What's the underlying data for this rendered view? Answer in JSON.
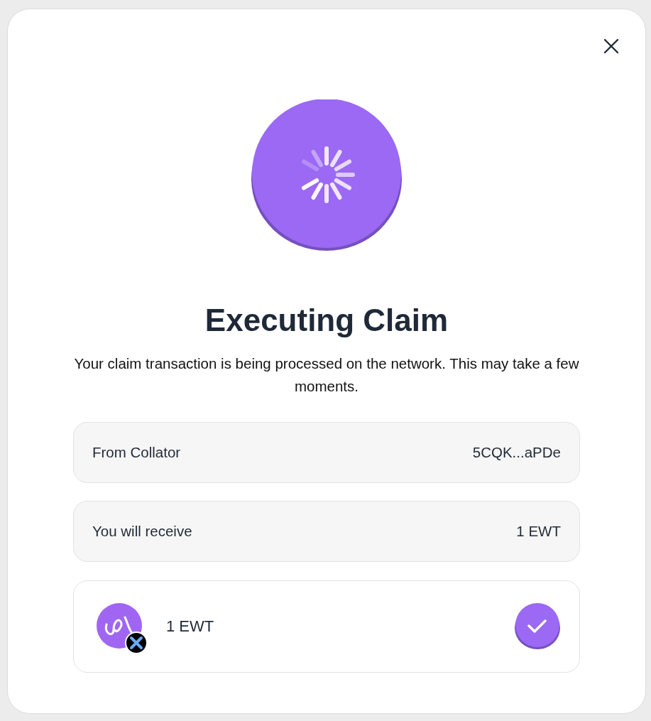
{
  "title": "Executing Claim",
  "description": "Your claim transaction is being processed on the network. This may take a few moments.",
  "details": [
    {
      "label": "From Collator",
      "value": "5CQK...aPDe"
    },
    {
      "label": "You will receive",
      "value": "1 EWT"
    }
  ],
  "asset": {
    "amount": "1 EWT"
  }
}
